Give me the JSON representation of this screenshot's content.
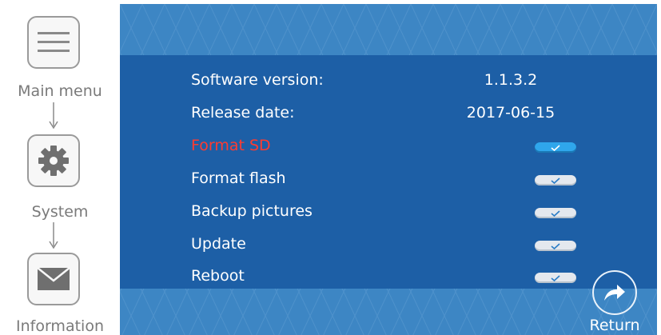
{
  "nav": {
    "items": [
      {
        "label": "Main menu",
        "icon": "hamburger-menu-icon"
      },
      {
        "label": "System",
        "icon": "gear-icon"
      },
      {
        "label": "Information",
        "icon": "envelope-icon"
      }
    ]
  },
  "info": {
    "software_version_label": "Software version:",
    "software_version_value": "1.1.3.2",
    "release_date_label": "Release date:",
    "release_date_value": "2017-06-15"
  },
  "actions": [
    {
      "label": "Format SD",
      "selected": true
    },
    {
      "label": "Format flash",
      "selected": false
    },
    {
      "label": "Backup pictures",
      "selected": false
    },
    {
      "label": "Update",
      "selected": false
    },
    {
      "label": "Reboot",
      "selected": false
    }
  ],
  "return_label": "Return",
  "colors": {
    "panel_blue": "#1d5fa6",
    "panel_light": "#3d86c4",
    "active_text": "#ff3b30",
    "active_toggle": "#2fa6ec"
  }
}
